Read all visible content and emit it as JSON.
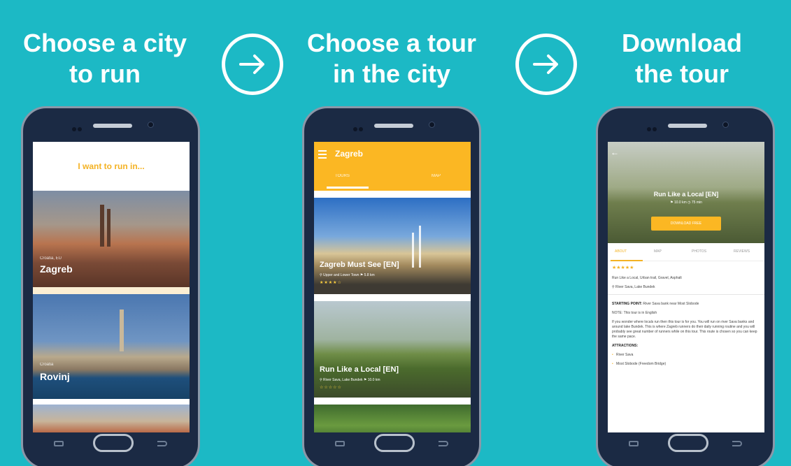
{
  "headlines": [
    {
      "line1": "Choose a city",
      "line2": "to run"
    },
    {
      "line1": "Choose a tour",
      "line2": "in the city"
    },
    {
      "line1": "Download",
      "line2": "the tour"
    }
  ],
  "colors": {
    "background": "#1cb9c5",
    "accent": "#fbb723",
    "phone": "#1b2a44"
  },
  "screen1": {
    "prompt": "I want to run in...",
    "cities": [
      {
        "sub": "Croatia, EU",
        "name": "Zagreb"
      },
      {
        "sub": "Croatia",
        "name": "Rovinj"
      }
    ]
  },
  "screen2": {
    "title": "Zagreb",
    "tabs": [
      "TOURS",
      "MAP"
    ],
    "tours": [
      {
        "title": "Zagreb Must See [EN]",
        "meta": "⚲ Upper and Lower Town  ⚑ 5.8 km",
        "stars": "★★★★☆"
      },
      {
        "title": "Run Like a Local [EN]",
        "meta": "⚲ River Sava, Lake Bundek  ⚑ 10.0 km",
        "stars": "☆☆☆☆☆"
      }
    ]
  },
  "screen3": {
    "hero_title": "Run Like a Local [EN]",
    "hero_meta": "⚑ 10.0 km  ◷ 75 min",
    "download_label": "DOWNLOAD FREE",
    "tabs": [
      "ABOUT",
      "MAP",
      "PHOTOS",
      "REVIEWS"
    ],
    "stars": "★★★★★",
    "tags": "Run Like a Local, Urban trail, Gravel, Asphalt",
    "location": "⚲ River Sava, Lake Bundek",
    "starting_label": "STARTING POINT:",
    "starting_value": " River Sava bank near Most Slobode",
    "note": "NOTE: This tour is in English",
    "description": "If you wonder where locals run then this tour is for you. You will run on river Sava banks and around lake Bundek. This is where Zagreb runners do their daily running routine and you will probably see great number of runners while on this tour. This route is chosen so you can keep the same pace.",
    "attractions_label": "ATTRACTIONS:",
    "attractions": [
      "River Sava",
      "Most Slobode (Freedom Bridge)"
    ]
  }
}
